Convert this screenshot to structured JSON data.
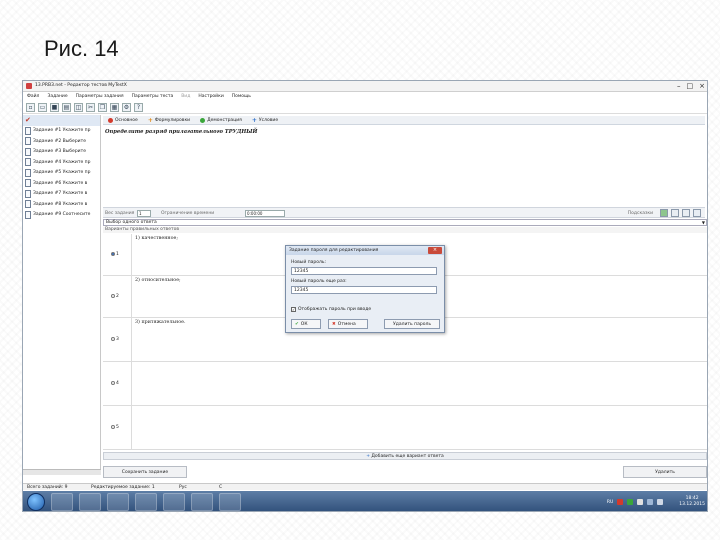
{
  "slide": {
    "title": "Рис. 14"
  },
  "window": {
    "title": "13.PRB3.net - Редактор тестов MyTestX"
  },
  "menu": [
    "Файл",
    "Задание",
    "Параметры задания",
    "Параметры теста",
    "Вид",
    "Настройки",
    "Помощь"
  ],
  "tasks": [
    "Задание #1 Укажите пр",
    "Задание #2 Выберите",
    "Задание #3 Выберите",
    "Задание #4 Укажите пр",
    "Задание #5 Укажите пр",
    "Задание #6 Укажите в",
    "Задание #7 Укажите в",
    "Задание #8 Укажите в",
    "Задание #9 Соотнесите"
  ],
  "editor_tabs": [
    "Основное",
    "Формулировки",
    "Демонстрация",
    "Условие"
  ],
  "question": "Определите разряд прилагательного ТРУДНЫЙ",
  "options_bar": {
    "weight_label": "Вес задания",
    "weight_value": "1",
    "time_label": "Ограничение времени",
    "time_value": "0:00:00",
    "hint_label": "Подсказки"
  },
  "task_type": "Выбор одного ответа",
  "answers_header": "Варианты правильных ответов",
  "answers": [
    {
      "num": "1",
      "text": "1) качественное;"
    },
    {
      "num": "2",
      "text": "2) относительное;"
    },
    {
      "num": "3",
      "text": "3) притяжательное."
    },
    {
      "num": "4",
      "text": ""
    },
    {
      "num": "5",
      "text": ""
    }
  ],
  "add_answer_label": "Добавить еще вариант ответа",
  "bottom": {
    "left_button": "Сохранить задание",
    "right_button": "Удалить"
  },
  "status": {
    "total": "Всего заданий: 9",
    "current": "Редактируемое задание: 1",
    "lang": "Рус",
    "indicator": "С"
  },
  "taskbar": {
    "lang": "RU",
    "time": "18:42",
    "date": "13.12.2015"
  },
  "dialog": {
    "title": "Задание пароля для редактирования",
    "new_password_label": "Новый пароль:",
    "new_password_value": "12345",
    "confirm_label": "Новый пароль еще раз:",
    "confirm_value": "12345",
    "show_password_label": "Отображать пароль при вводе",
    "ok_label": "ОК",
    "cancel_label": "Отмена",
    "remove_label": "Удалить пароль"
  },
  "colors": {
    "accent_green": "#3aa63a",
    "accent_red": "#d33a2c",
    "accent_orange": "#e08a1a",
    "accent_blue": "#2c6ec9",
    "taskbar": "#2f4e79"
  }
}
